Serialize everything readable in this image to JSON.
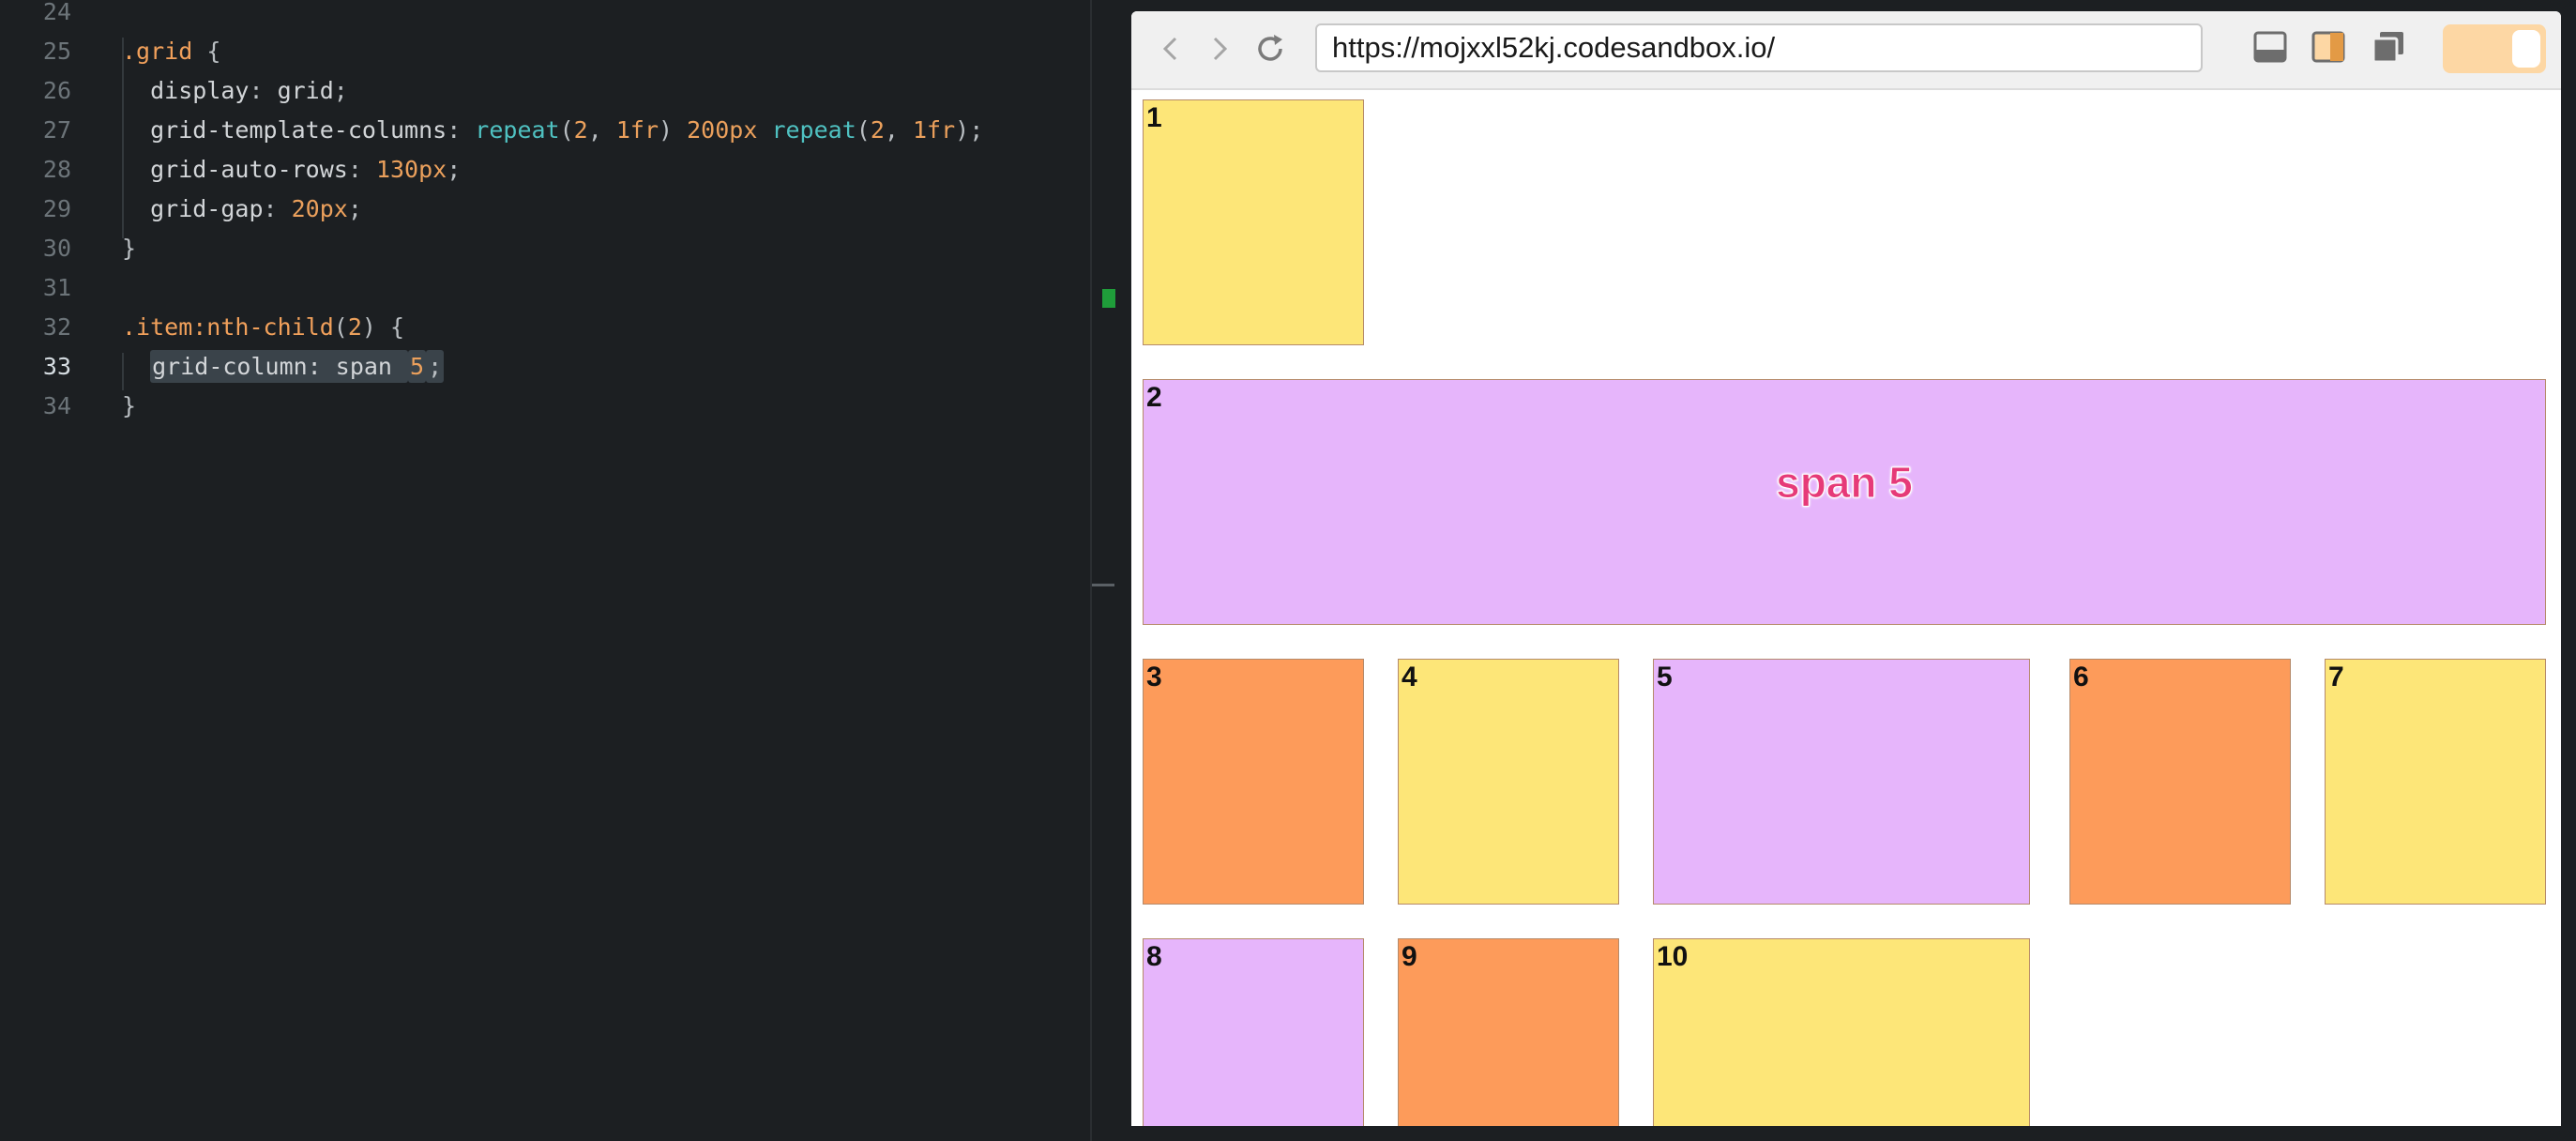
{
  "editor": {
    "lines": [
      {
        "num": "24",
        "tokens": []
      },
      {
        "num": "25",
        "tokens": [
          {
            "t": ".grid",
            "c": "t-sel"
          },
          {
            "t": " {",
            "c": "t-punc"
          }
        ]
      },
      {
        "num": "26",
        "tokens": [
          {
            "t": "  display",
            "c": "t-prop"
          },
          {
            "t": ": ",
            "c": "t-punc"
          },
          {
            "t": "grid",
            "c": "t-plain"
          },
          {
            "t": ";",
            "c": "t-punc"
          }
        ]
      },
      {
        "num": "27",
        "tokens": [
          {
            "t": "  grid-template-columns",
            "c": "t-prop"
          },
          {
            "t": ": ",
            "c": "t-punc"
          },
          {
            "t": "repeat",
            "c": "t-fn"
          },
          {
            "t": "(",
            "c": "t-punc"
          },
          {
            "t": "2",
            "c": "t-num"
          },
          {
            "t": ", ",
            "c": "t-punc"
          },
          {
            "t": "1fr",
            "c": "t-num"
          },
          {
            "t": ") ",
            "c": "t-punc"
          },
          {
            "t": "200px",
            "c": "t-num"
          },
          {
            "t": " ",
            "c": "t-punc"
          },
          {
            "t": "repeat",
            "c": "t-fn"
          },
          {
            "t": "(",
            "c": "t-punc"
          },
          {
            "t": "2",
            "c": "t-num"
          },
          {
            "t": ", ",
            "c": "t-punc"
          },
          {
            "t": "1fr",
            "c": "t-num"
          },
          {
            "t": ");",
            "c": "t-punc"
          }
        ]
      },
      {
        "num": "28",
        "tokens": [
          {
            "t": "  grid-auto-rows",
            "c": "t-prop"
          },
          {
            "t": ": ",
            "c": "t-punc"
          },
          {
            "t": "130px",
            "c": "t-num"
          },
          {
            "t": ";",
            "c": "t-punc"
          }
        ]
      },
      {
        "num": "29",
        "tokens": [
          {
            "t": "  grid-gap",
            "c": "t-prop"
          },
          {
            "t": ": ",
            "c": "t-punc"
          },
          {
            "t": "20px",
            "c": "t-num"
          },
          {
            "t": ";",
            "c": "t-punc"
          }
        ]
      },
      {
        "num": "30",
        "tokens": [
          {
            "t": "}",
            "c": "t-punc"
          }
        ]
      },
      {
        "num": "31",
        "tokens": []
      },
      {
        "num": "32",
        "tokens": [
          {
            "t": ".item:nth-child",
            "c": "t-sel"
          },
          {
            "t": "(",
            "c": "t-punc"
          },
          {
            "t": "2",
            "c": "t-num"
          },
          {
            "t": ") {",
            "c": "t-punc"
          }
        ]
      },
      {
        "num": "33",
        "active": true,
        "tokens": [
          {
            "t": "  ",
            "c": "t-plain"
          },
          {
            "t": "grid-column: span ",
            "c": "t-prop sel-hl",
            "hl": true
          },
          {
            "t": "5",
            "c": "t-num sel-hl",
            "hl": true
          },
          {
            "t": ";",
            "c": "t-punc sel-hl",
            "hl": true
          }
        ]
      },
      {
        "num": "34",
        "tokens": [
          {
            "t": "}",
            "c": "t-punc"
          }
        ]
      }
    ]
  },
  "browser": {
    "url": "https://mojxxl52kj.codesandbox.io/",
    "back_icon": "chevron-left-icon",
    "forward_icon": "chevron-right-icon",
    "reload_icon": "reload-icon",
    "accent": "#fdd7a4"
  },
  "grid": {
    "span_label": "span 5",
    "items": [
      {
        "label": "1",
        "color": "yellow"
      },
      {
        "label": "2",
        "color": "purple"
      },
      {
        "label": "3",
        "color": "orange"
      },
      {
        "label": "4",
        "color": "yellow"
      },
      {
        "label": "5",
        "color": "purple"
      },
      {
        "label": "6",
        "color": "orange"
      },
      {
        "label": "7",
        "color": "yellow"
      },
      {
        "label": "8",
        "color": "purple"
      },
      {
        "label": "9",
        "color": "orange"
      },
      {
        "label": "10",
        "color": "yellow"
      }
    ]
  }
}
